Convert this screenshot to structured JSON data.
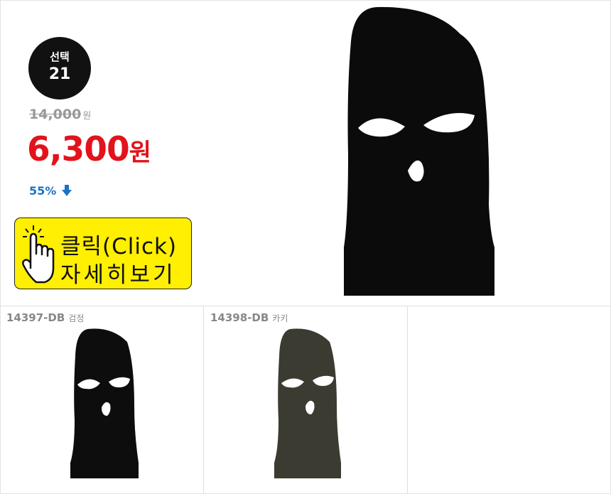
{
  "main": {
    "badge": {
      "line1": "선택",
      "line2": "21"
    },
    "original_price": {
      "amount": "14,000",
      "unit": "원"
    },
    "sale_price": {
      "amount": "6,300",
      "unit": "원"
    },
    "discount": {
      "percent": "55%"
    },
    "cta": {
      "line1": "클릭(Click)",
      "line2": "자세히보기",
      "background": "#ffef00"
    },
    "product_image": "black-balaclava-image"
  },
  "options": [
    {
      "code": "14397-DB",
      "color": "검정",
      "image": "black-balaclava-thumb",
      "fill": "#0d0d0d"
    },
    {
      "code": "14398-DB",
      "color": "카키",
      "image": "khaki-balaclava-thumb",
      "fill": "#3b3b32"
    }
  ],
  "colors": {
    "sale": "#e3121b",
    "discount": "#1a73c8",
    "badge": "#111111"
  }
}
